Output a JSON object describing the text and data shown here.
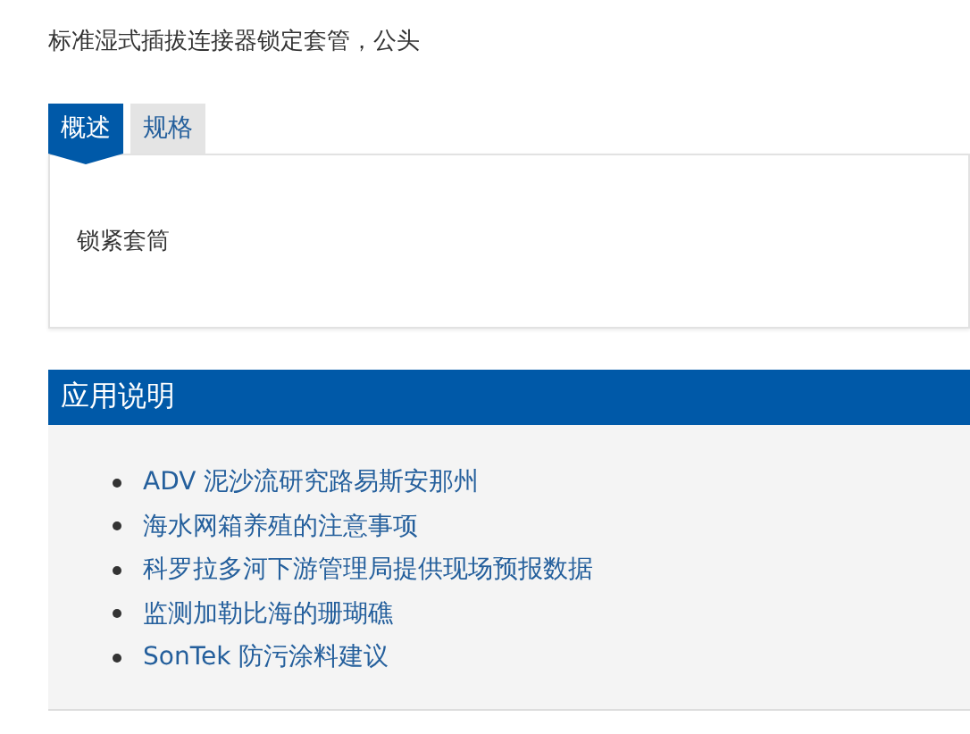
{
  "title": "标准湿式插拔连接器锁定套管，公头",
  "tabs": [
    {
      "label": "概述",
      "selected": true
    },
    {
      "label": "规格",
      "selected": false
    }
  ],
  "tab_content": "锁紧套筒",
  "application_notes": {
    "heading": "应用说明",
    "links": [
      "ADV 泥沙流研究路易斯安那州",
      "海水网箱养殖的注意事项",
      "科罗拉多河下游管理局提供现场预报数据",
      "监测加勒比海的珊瑚礁",
      "SonTek 防污涂料建议"
    ]
  }
}
